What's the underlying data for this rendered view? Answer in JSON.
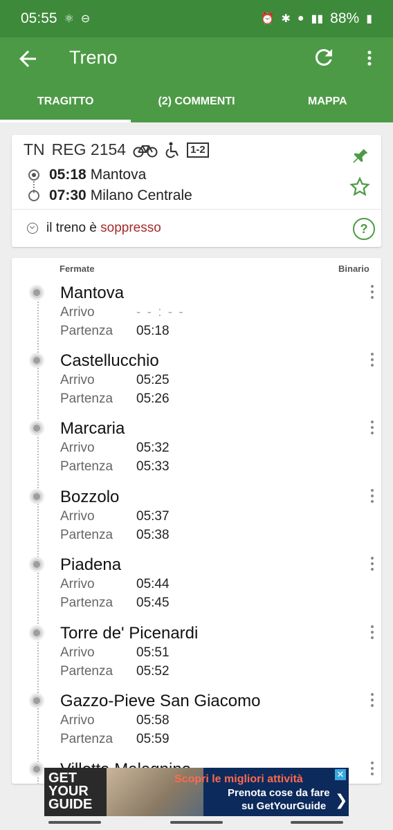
{
  "status_bar": {
    "time": "05:55",
    "battery": "88%"
  },
  "app_bar": {
    "title": "Treno"
  },
  "tabs": [
    {
      "label": "TRAGITTO",
      "active": true
    },
    {
      "label": "(2) COMMENTI",
      "active": false
    },
    {
      "label": "MAPPA",
      "active": false
    }
  ],
  "train": {
    "category": "TN",
    "number": "REG 2154",
    "class": "1-2",
    "departure_time": "05:18",
    "departure_station": "Mantova",
    "arrival_time": "07:30",
    "arrival_station": "Milano Centrale",
    "status_prefix": "il treno è",
    "status_value": "soppresso",
    "status_color": "#a52a2a"
  },
  "stops_header": {
    "col_stops": "Fermate",
    "col_platform": "Binario"
  },
  "labels": {
    "arrival": "Arrivo",
    "departure": "Partenza"
  },
  "stops": [
    {
      "name": "Mantova",
      "arrival": "- - : - -",
      "departure": "05:18"
    },
    {
      "name": "Castellucchio",
      "arrival": "05:25",
      "departure": "05:26"
    },
    {
      "name": "Marcaria",
      "arrival": "05:32",
      "departure": "05:33"
    },
    {
      "name": "Bozzolo",
      "arrival": "05:37",
      "departure": "05:38"
    },
    {
      "name": "Piadena",
      "arrival": "05:44",
      "departure": "05:45"
    },
    {
      "name": "Torre de' Picenardi",
      "arrival": "05:51",
      "departure": "05:52"
    },
    {
      "name": "Gazzo-Pieve San Giacomo",
      "arrival": "05:58",
      "departure": "05:59"
    },
    {
      "name": "Villetta Malagnino",
      "arrival": "",
      "departure": ""
    }
  ],
  "ad": {
    "logo": "GET YOUR GUIDE",
    "line1": "Scopri le migliori attività",
    "line2": "Prenota cose da fare",
    "line3": "su GetYourGuide"
  },
  "colors": {
    "app_bar": "#4c9a45",
    "status_bar": "#3e8a3b",
    "accent": "#4c9a45"
  }
}
